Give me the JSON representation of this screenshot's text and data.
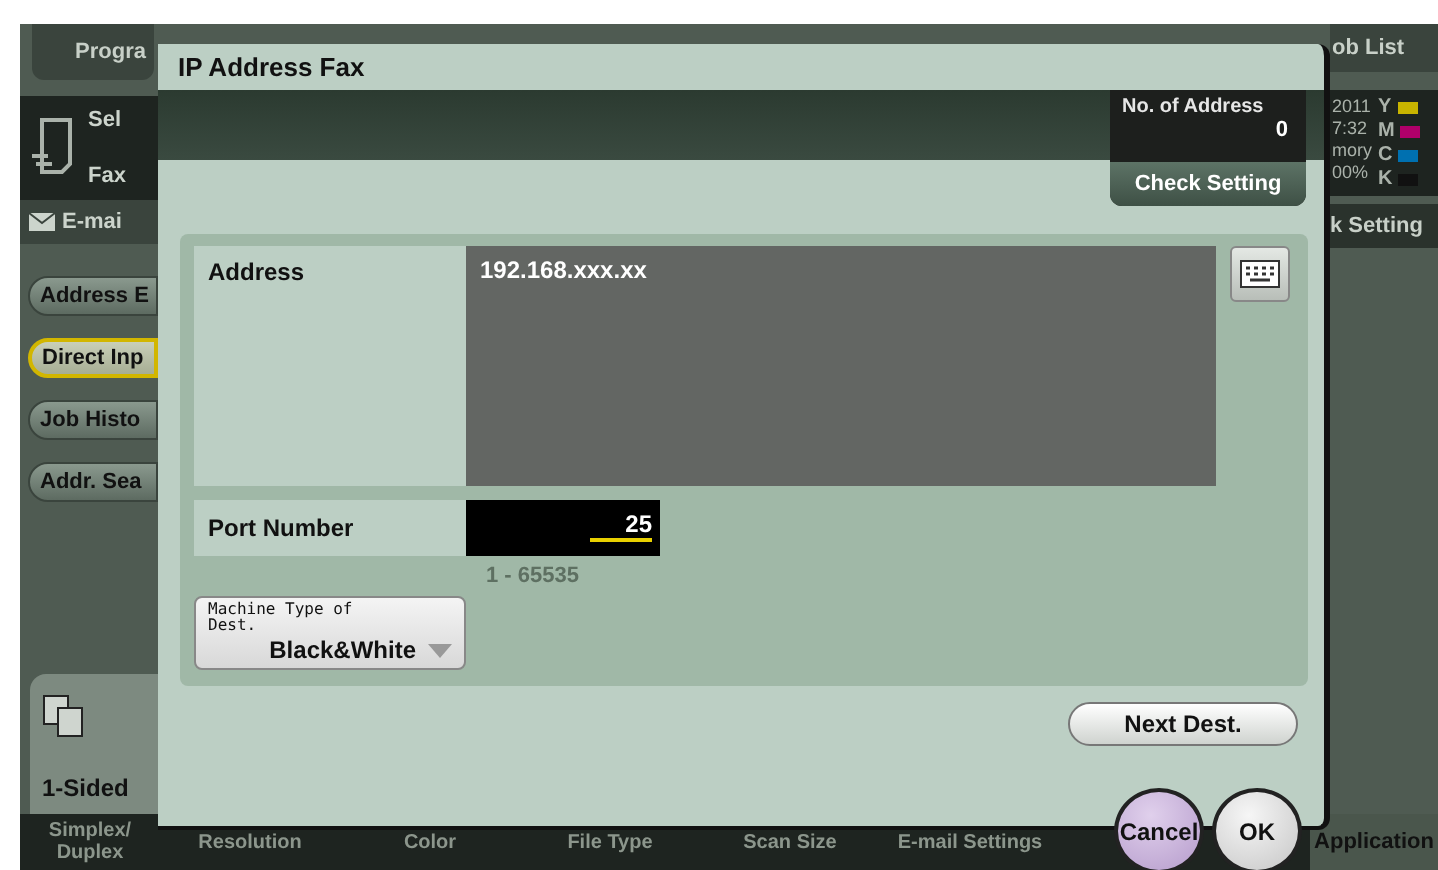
{
  "background": {
    "program_tab": "Progra",
    "source": {
      "title": "Sel",
      "mode": "Fax"
    },
    "email_item": "E-mai",
    "side_buttons": [
      {
        "label": "Address E",
        "selected": false
      },
      {
        "label": "Direct Inp",
        "selected": true
      },
      {
        "label": "Job Histo",
        "selected": false
      },
      {
        "label": "Addr. Sea",
        "selected": false
      }
    ],
    "duplex_tile": "1-Sided",
    "bottom_tabs": [
      "Simplex/ Duplex",
      "Resolution",
      "Color",
      "File Type",
      "Scan Size",
      "E-mail Settings"
    ],
    "job_list": "ob List",
    "status": {
      "lines": [
        "2011",
        "7:32",
        "mory",
        "00%"
      ],
      "toners": [
        {
          "label": "Y",
          "color": "#c8b400"
        },
        {
          "label": "M",
          "color": "#b0006a"
        },
        {
          "label": "C",
          "color": "#0070b0"
        },
        {
          "label": "K",
          "color": "#111111"
        }
      ]
    },
    "check_setting": "k Setting",
    "application": "Application"
  },
  "dialog": {
    "title": "IP Address Fax",
    "summary": {
      "label": "No. of Address",
      "count": "0",
      "button": "Check Setting"
    },
    "address": {
      "label": "Address",
      "value": "192.168.xxx.xx"
    },
    "port": {
      "label": "Port Number",
      "value": "25",
      "range": "1 - 65535"
    },
    "machine_type": {
      "label": "Machine Type of Dest.",
      "value": "Black&White"
    },
    "next_button": "Next Dest.",
    "cancel_button": "Cancel",
    "ok_button": "OK"
  }
}
